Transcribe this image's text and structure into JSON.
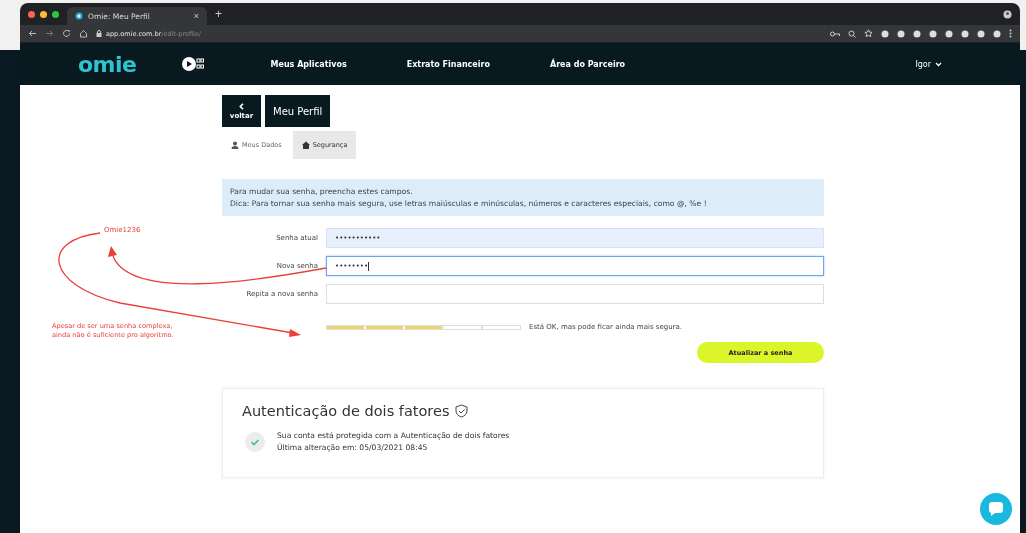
{
  "browser": {
    "tab_title": "Omie: Meu Perfil",
    "tab_close": "×",
    "new_tab": "+",
    "url_host": "app.omie.com.br",
    "url_path": "/edit-profile/"
  },
  "nav": {
    "logo": "omie",
    "links": [
      "Meus Aplicativos",
      "Extrato Financeiro",
      "Área do Parceiro"
    ],
    "user": "Igor"
  },
  "header": {
    "back_label": "voltar",
    "title": "Meu Perfil"
  },
  "tabs": [
    {
      "label": "Meus Dados",
      "selected": false
    },
    {
      "label": "Segurança",
      "selected": true
    }
  ],
  "info": [
    "Para mudar sua senha, preencha estes campos.",
    "Dica: Para tornar sua senha mais segura, use letras maiúsculas e minúsculas, números e caracteres especiais, como @, %e !"
  ],
  "fields": [
    {
      "label": "Senha atual",
      "value": "•••••••••••",
      "autofilled": true,
      "focused": false
    },
    {
      "label": "Nova senha",
      "value": "••••••••",
      "autofilled": false,
      "focused": true
    },
    {
      "label": "Repita a nova senha",
      "autofilled": false,
      "focused": false
    }
  ],
  "strength": {
    "level": 0.6,
    "message": "Está OK, mas pode ficar ainda mais segura."
  },
  "submit": "Atualizar a senha",
  "two_factor": {
    "title": "Autenticação de dois fatores",
    "enabled": true,
    "lines": [
      "Sua conta está protegida com a Autenticação de dois fatores",
      "Última alteração em: 05/03/2021 08:45"
    ]
  },
  "annotations": {
    "password": "Omie1236",
    "note": [
      "Apesar de ser uma senha complexa,",
      "ainda não é suficiente pro algoritmo."
    ]
  }
}
